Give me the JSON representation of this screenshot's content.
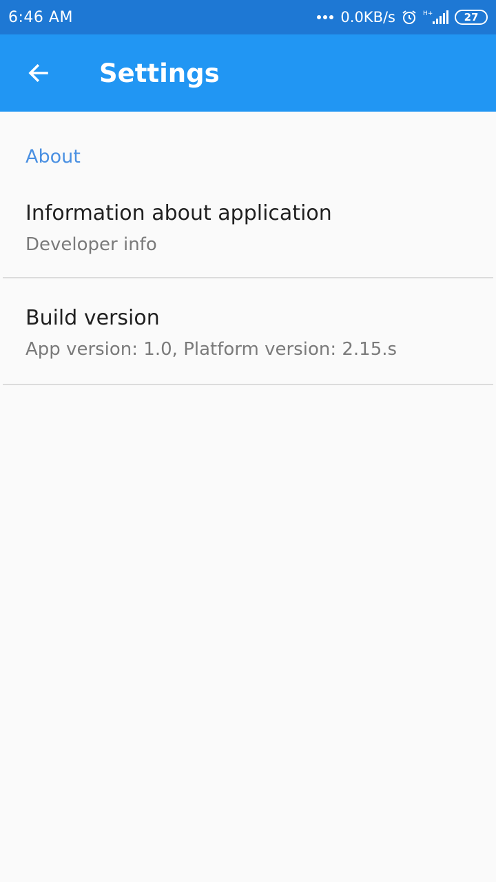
{
  "status_bar": {
    "time": "6:46 AM",
    "network_speed": "0.0KB/s",
    "signal_type": "H+",
    "battery": "27"
  },
  "app_bar": {
    "title": "Settings",
    "back_icon": "arrow-left-icon"
  },
  "settings": {
    "section_header": "About",
    "items": [
      {
        "title": "Information about application",
        "subtitle": "Developer info"
      },
      {
        "title": "Build version",
        "subtitle": "App version: 1.0, Platform version: 2.15.s"
      }
    ]
  },
  "colors": {
    "status_bar": "#1e78d4",
    "app_bar": "#2196f3",
    "section_header": "#4a90e2",
    "background": "#fafafa"
  }
}
